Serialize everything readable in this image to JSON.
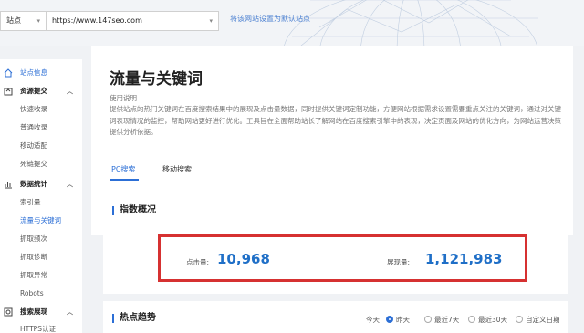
{
  "topbar": {
    "site_select_label": "站点",
    "url_value": "https://www.147seo.com",
    "set_default_link": "将该网站设置为默认站点"
  },
  "sidebar": {
    "items": [
      {
        "label": "站点信息",
        "icon": "home-icon"
      },
      {
        "label": "资源提交",
        "icon": "upload-icon"
      },
      {
        "label": "快速收录"
      },
      {
        "label": "普通收录"
      },
      {
        "label": "移动适配"
      },
      {
        "label": "死链提交"
      },
      {
        "label": "数据统计",
        "icon": "chart-icon"
      },
      {
        "label": "索引量"
      },
      {
        "label": "流量与关键词"
      },
      {
        "label": "抓取频次"
      },
      {
        "label": "抓取诊断"
      },
      {
        "label": "抓取异常"
      },
      {
        "label": "Robots"
      },
      {
        "label": "搜索展现",
        "icon": "display-icon"
      },
      {
        "label": "HTTPS认证"
      }
    ]
  },
  "main": {
    "title": "流量与关键词",
    "usage_title": "使用说明",
    "description": "提供站点的热门关键词在百度搜索结果中的展现及点击量数据，同时提供关键词定制功能，方便网站根据需求设置需要重点关注的关键词，通过对关键词表现情况的监控，帮助网站更好进行优化。工具旨在全面帮助站长了解网站在百度搜索引擎中的表现，决定页面及网站的优化方向，为网站运营决策提供分析依据。",
    "tabs": [
      "PC搜索",
      "移动搜索"
    ]
  },
  "overview": {
    "title": "指数概况",
    "click_label": "点击量:",
    "click_value": "10,968",
    "impression_label": "展现量:",
    "impression_value": "1,121,983"
  },
  "trend": {
    "title": "热点趋势",
    "options": [
      "今天",
      "昨天",
      "最近7天",
      "最近30天",
      "自定义日期"
    ],
    "selected": "昨天"
  },
  "colors": {
    "accent": "#2c6fd6",
    "value_blue": "#1f6fc7",
    "highlight_red": "#d63131"
  }
}
